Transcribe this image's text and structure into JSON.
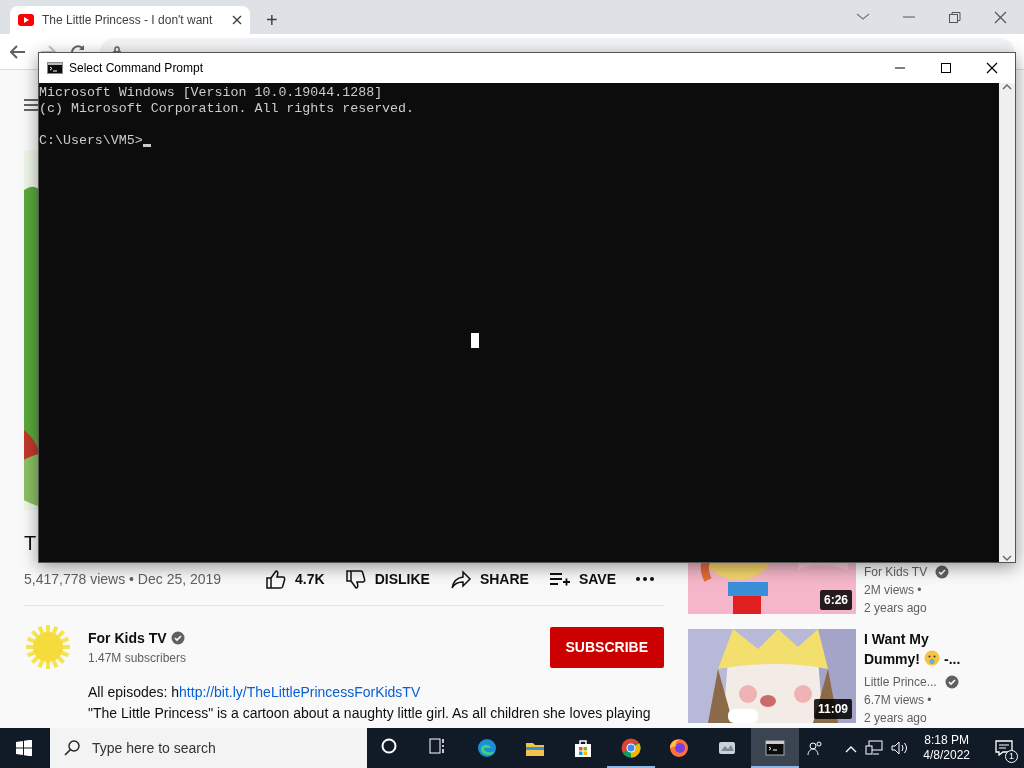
{
  "browser": {
    "tab": {
      "title": "The Little Princess - I don't want",
      "selected": true
    },
    "new_tab": "+"
  },
  "video": {
    "title": "T",
    "stats": "5,417,778 views • Dec 25, 2019",
    "actions": [
      {
        "kind": "like",
        "label": "4.7K"
      },
      {
        "kind": "dislike",
        "label": "DISLIKE"
      },
      {
        "kind": "share",
        "label": "SHARE"
      },
      {
        "kind": "save",
        "label": "SAVE"
      }
    ]
  },
  "channel": {
    "name": "For Kids TV",
    "verified": true,
    "subscribers": "1.47M subscribers",
    "subscribe": "SUBSCRIBE"
  },
  "description": {
    "prefix": "All episodes: h",
    "link": "http://bit.ly/TheLittlePrincessForKidsTV",
    "line_2": "\"The Little Princess\" is a cartoon about a naughty little girl. As all children she loves playing"
  },
  "related": [
    {
      "channel": "For Kids TV",
      "verified": true,
      "views": "2M views •",
      "age": "2 years ago",
      "duration": "6:26"
    },
    {
      "title": "I Want My",
      "title_2": "Dummy!",
      "title_end": "-...",
      "channel": "Little Prince...",
      "verified": true,
      "views": "6.7M views •",
      "age": "2 years ago",
      "duration": "11:09"
    }
  ],
  "console": {
    "title": "Select Command Prompt",
    "lines": [
      "Microsoft Windows [Version 10.0.19044.1288]",
      "(c) Microsoft Corporation. All rights reserved."
    ],
    "prompt": "C:\\Users\\VM5>"
  },
  "taskbar": {
    "search_placeholder": "Type here to search",
    "apps": [
      {
        "kind": "cortana",
        "running": false,
        "selected": false
      },
      {
        "kind": "taskview",
        "running": false,
        "selected": false
      },
      {
        "kind": "edge",
        "running": false,
        "selected": false
      },
      {
        "kind": "explorer",
        "running": false,
        "selected": false
      },
      {
        "kind": "store",
        "running": false,
        "selected": false
      },
      {
        "kind": "chrome",
        "running": true,
        "selected": false
      },
      {
        "kind": "firefox",
        "running": false,
        "selected": false
      },
      {
        "kind": "app",
        "running": false,
        "selected": false
      },
      {
        "kind": "cmd",
        "running": true,
        "selected": true
      }
    ],
    "time": "8:18 PM",
    "date": "4/8/2022",
    "notifications": "1"
  }
}
